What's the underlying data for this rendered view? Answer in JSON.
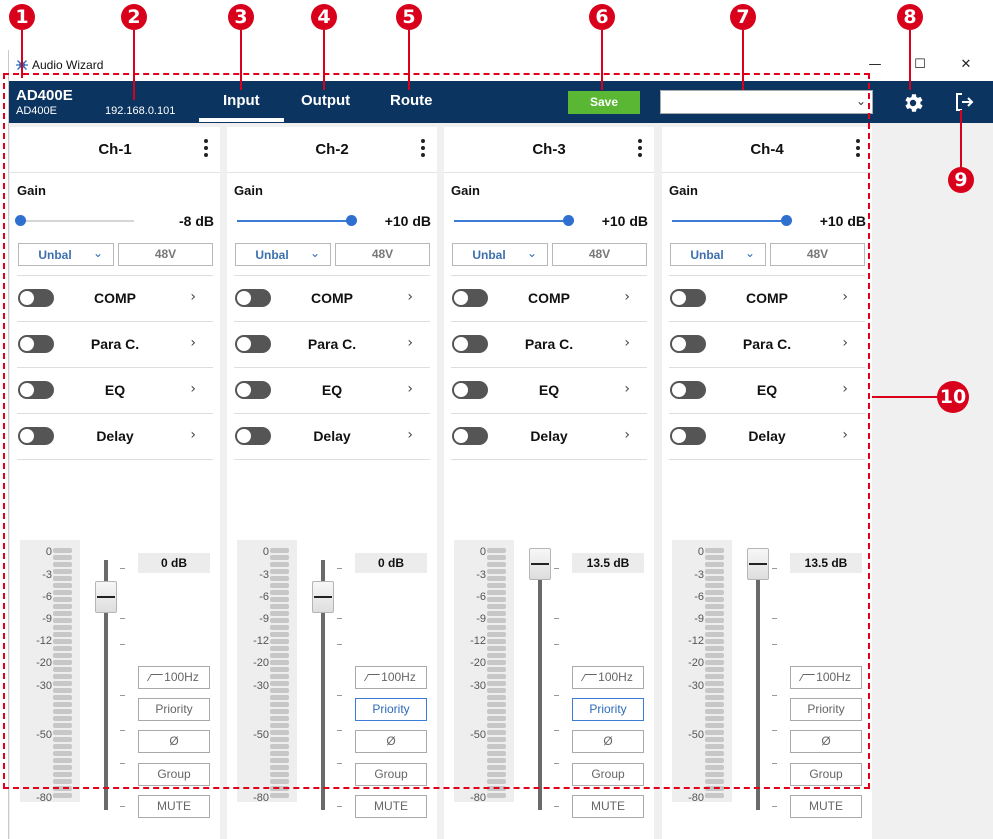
{
  "window": {
    "title": "Audio Wizard",
    "min_glyph": "—",
    "max_glyph": "☐",
    "close_glyph": "✕"
  },
  "device": {
    "name": "AD400E",
    "model": "AD400E",
    "ip": "192.168.0.101"
  },
  "tabs": [
    {
      "label": "Input",
      "active": true
    },
    {
      "label": "Output",
      "active": false
    },
    {
      "label": "Route",
      "active": false
    }
  ],
  "toolbar": {
    "save_label": "Save",
    "device_select_value": ""
  },
  "colors": {
    "appbar": "#0c3461",
    "save": "#5ab734",
    "accent": "#3a7bd5",
    "callout": "#d9001b"
  },
  "callouts": [
    "1",
    "2",
    "3",
    "4",
    "5",
    "6",
    "7",
    "8",
    "9",
    "10"
  ],
  "meter_ticks": [
    "0",
    "-3",
    "-6",
    "-9",
    "-12",
    "-20",
    "-30",
    "-50",
    "-80"
  ],
  "channels": [
    {
      "title": "Ch-1",
      "gain_label": "Gain",
      "gain_value": "-8  dB",
      "gain_level": 0.0,
      "input_mode": "Unbal",
      "phantom_label": "48V",
      "effects": [
        {
          "label": "COMP",
          "on": false
        },
        {
          "label": "Para C.",
          "on": false
        },
        {
          "label": "EQ",
          "on": false
        },
        {
          "label": "Delay",
          "on": false
        }
      ],
      "fader_value": "0 dB",
      "fader_level": 0.85,
      "buttons": {
        "hpf": "100Hz",
        "priority": "Priority",
        "priority_active": false,
        "phase": "Ø",
        "group": "Group",
        "mute": "MUTE"
      }
    },
    {
      "title": "Ch-2",
      "gain_label": "Gain",
      "gain_value": "+10  dB",
      "gain_level": 1.0,
      "input_mode": "Unbal",
      "phantom_label": "48V",
      "effects": [
        {
          "label": "COMP",
          "on": false
        },
        {
          "label": "Para C.",
          "on": false
        },
        {
          "label": "EQ",
          "on": false
        },
        {
          "label": "Delay",
          "on": false
        }
      ],
      "fader_value": "0 dB",
      "fader_level": 0.85,
      "buttons": {
        "hpf": "100Hz",
        "priority": "Priority",
        "priority_active": true,
        "phase": "Ø",
        "group": "Group",
        "mute": "MUTE"
      }
    },
    {
      "title": "Ch-3",
      "gain_label": "Gain",
      "gain_value": "+10  dB",
      "gain_level": 1.0,
      "input_mode": "Unbal",
      "phantom_label": "48V",
      "effects": [
        {
          "label": "COMP",
          "on": false
        },
        {
          "label": "Para C.",
          "on": false
        },
        {
          "label": "EQ",
          "on": false
        },
        {
          "label": "Delay",
          "on": false
        }
      ],
      "fader_value": "13.5 dB",
      "fader_level": 1.0,
      "buttons": {
        "hpf": "100Hz",
        "priority": "Priority",
        "priority_active": true,
        "phase": "Ø",
        "group": "Group",
        "mute": "MUTE"
      }
    },
    {
      "title": "Ch-4",
      "gain_label": "Gain",
      "gain_value": "+10  dB",
      "gain_level": 1.0,
      "input_mode": "Unbal",
      "phantom_label": "48V",
      "effects": [
        {
          "label": "COMP",
          "on": false
        },
        {
          "label": "Para C.",
          "on": false
        },
        {
          "label": "EQ",
          "on": false
        },
        {
          "label": "Delay",
          "on": false
        }
      ],
      "fader_value": "13.5 dB",
      "fader_level": 1.0,
      "buttons": {
        "hpf": "100Hz",
        "priority": "Priority",
        "priority_active": false,
        "phase": "Ø",
        "group": "Group",
        "mute": "MUTE"
      }
    }
  ]
}
